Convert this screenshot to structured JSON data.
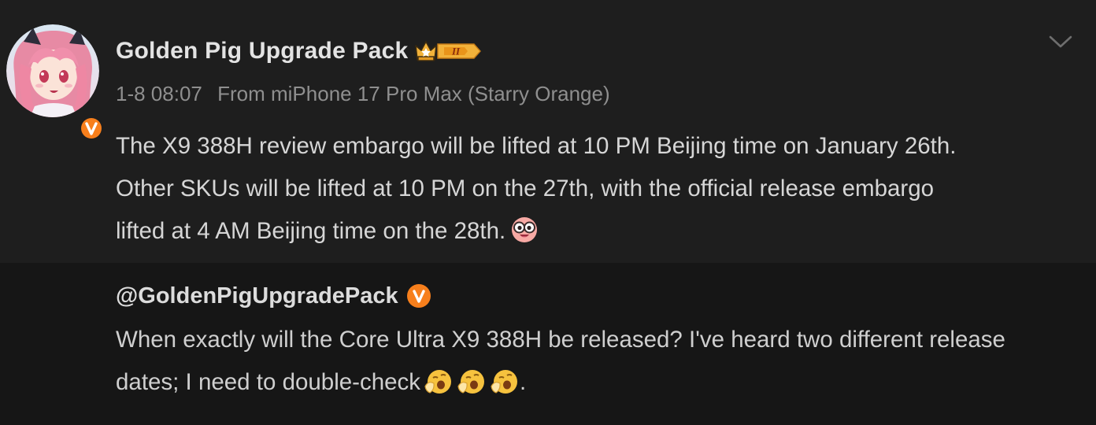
{
  "post": {
    "author": {
      "name": "Golden Pig Upgrade Pack",
      "verified": true,
      "member_level": "II",
      "avatar_icon": "anime-girl-avatar"
    },
    "meta": {
      "time": "1-8 08:07",
      "source": "From miPhone 17 Pro Max (Starry Orange)"
    },
    "text_lines": [
      "The X9 388H review embargo will be lifted at 10 PM Beijing time on January 26th.",
      "Other SKUs will be lifted at 10 PM on the 27th, with the official release embargo",
      "lifted at 4 AM Beijing time on the 28th."
    ],
    "emoji": "glasses-face-emoji",
    "menu_icon": "chevron-down-icon"
  },
  "quoted": {
    "author": {
      "handle": "@GoldenPigUpgradePack",
      "verified": true
    },
    "text_lines": [
      "When exactly will the Core Ultra X9 388H be released? I've heard two different release",
      "dates; I need to double-check"
    ],
    "trailing_text": ".",
    "emojis": [
      "yawn-emoji",
      "yawn-emoji",
      "yawn-emoji"
    ]
  },
  "colors": {
    "background_post": "#1e1e1e",
    "background_quoted": "#161616",
    "text_primary": "#d6d6d6",
    "text_meta": "#8f8f8f",
    "verified_orange": "#f77f1c",
    "badge_gold": "#f2b23a"
  }
}
